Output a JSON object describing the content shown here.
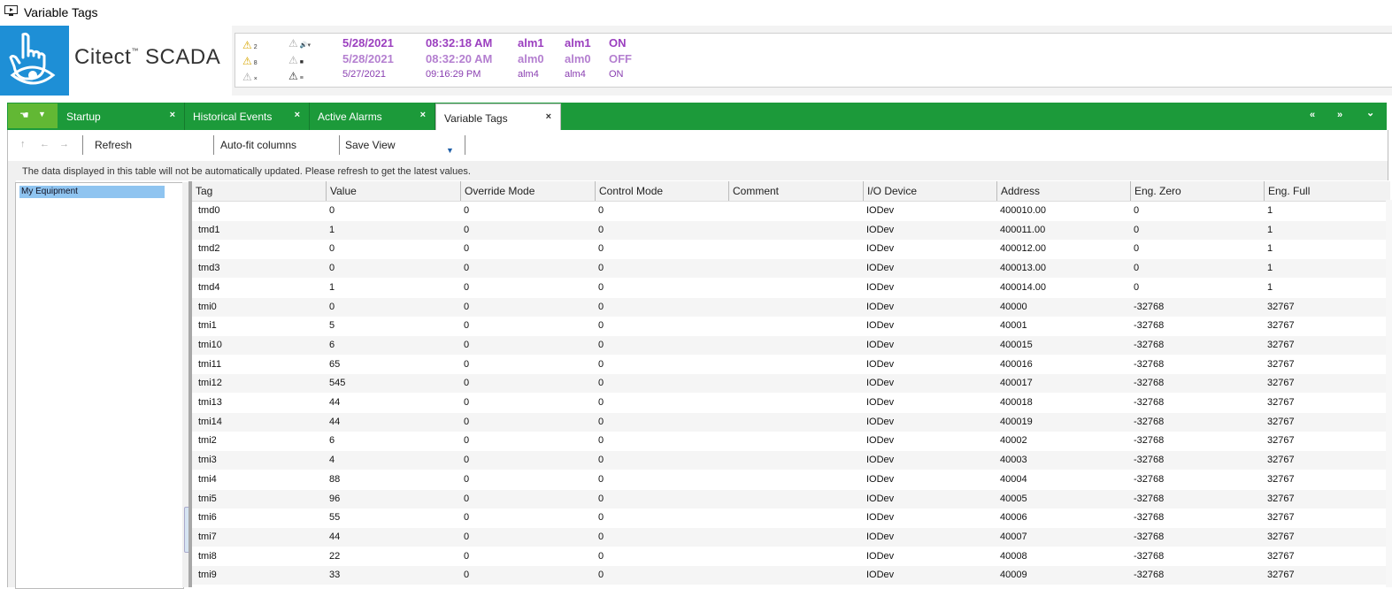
{
  "window": {
    "title": "Variable Tags"
  },
  "brand": {
    "name": "Citect",
    "tm": "™",
    "product": "SCADA",
    "accent": "#1e8fd6"
  },
  "alarm_icons": {
    "count_top": "2",
    "count_mid": "8"
  },
  "alarms": [
    {
      "date": "5/28/2021",
      "time": "08:32:18 AM",
      "tag": "alm1",
      "name": "alm1",
      "state": "ON"
    },
    {
      "date": "5/28/2021",
      "time": "08:32:20 AM",
      "tag": "alm0",
      "name": "alm0",
      "state": "OFF"
    },
    {
      "date": "5/27/2021",
      "time": "09:16:29 PM",
      "tag": "alm4",
      "name": "alm4",
      "state": "ON"
    }
  ],
  "tabs": [
    {
      "label": "Startup",
      "close": "×"
    },
    {
      "label": "Historical Events",
      "close": "×"
    },
    {
      "label": "Active Alarms",
      "close": "×"
    },
    {
      "label": "Variable Tags",
      "close": "×"
    }
  ],
  "tabbar": {
    "color": "#1c9a3a",
    "nav_prev": "«",
    "nav_next": "»",
    "nav_menu": "⌄"
  },
  "toolbar": {
    "back": "↑",
    "prev": "←",
    "next": "→",
    "refresh": "Refresh",
    "autofit": "Auto-fit columns",
    "saveview": "Save View",
    "dropdown": "▼"
  },
  "notice": "The data displayed in this table will not be automatically updated. Please refresh to get the latest values.",
  "tree": {
    "root": "My Equipment"
  },
  "grid": {
    "columns": [
      "Tag",
      "Value",
      "Override Mode",
      "Control Mode",
      "Comment",
      "I/O Device",
      "Address",
      "Eng. Zero",
      "Eng. Full"
    ],
    "rows": [
      [
        "tmd0",
        "0",
        "0",
        "0",
        "",
        "IODev",
        "400010.00",
        "0",
        "1"
      ],
      [
        "tmd1",
        "1",
        "0",
        "0",
        "",
        "IODev",
        "400011.00",
        "0",
        "1"
      ],
      [
        "tmd2",
        "0",
        "0",
        "0",
        "",
        "IODev",
        "400012.00",
        "0",
        "1"
      ],
      [
        "tmd3",
        "0",
        "0",
        "0",
        "",
        "IODev",
        "400013.00",
        "0",
        "1"
      ],
      [
        "tmd4",
        "1",
        "0",
        "0",
        "",
        "IODev",
        "400014.00",
        "0",
        "1"
      ],
      [
        "tmi0",
        "0",
        "0",
        "0",
        "",
        "IODev",
        "40000",
        "-32768",
        "32767"
      ],
      [
        "tmi1",
        "5",
        "0",
        "0",
        "",
        "IODev",
        "40001",
        "-32768",
        "32767"
      ],
      [
        "tmi10",
        "6",
        "0",
        "0",
        "",
        "IODev",
        "400015",
        "-32768",
        "32767"
      ],
      [
        "tmi11",
        "65",
        "0",
        "0",
        "",
        "IODev",
        "400016",
        "-32768",
        "32767"
      ],
      [
        "tmi12",
        "545",
        "0",
        "0",
        "",
        "IODev",
        "400017",
        "-32768",
        "32767"
      ],
      [
        "tmi13",
        "44",
        "0",
        "0",
        "",
        "IODev",
        "400018",
        "-32768",
        "32767"
      ],
      [
        "tmi14",
        "44",
        "0",
        "0",
        "",
        "IODev",
        "400019",
        "-32768",
        "32767"
      ],
      [
        "tmi2",
        "6",
        "0",
        "0",
        "",
        "IODev",
        "40002",
        "-32768",
        "32767"
      ],
      [
        "tmi3",
        "4",
        "0",
        "0",
        "",
        "IODev",
        "40003",
        "-32768",
        "32767"
      ],
      [
        "tmi4",
        "88",
        "0",
        "0",
        "",
        "IODev",
        "40004",
        "-32768",
        "32767"
      ],
      [
        "tmi5",
        "96",
        "0",
        "0",
        "",
        "IODev",
        "40005",
        "-32768",
        "32767"
      ],
      [
        "tmi6",
        "55",
        "0",
        "0",
        "",
        "IODev",
        "40006",
        "-32768",
        "32767"
      ],
      [
        "tmi7",
        "44",
        "0",
        "0",
        "",
        "IODev",
        "40007",
        "-32768",
        "32767"
      ],
      [
        "tmi8",
        "22",
        "0",
        "0",
        "",
        "IODev",
        "40008",
        "-32768",
        "32767"
      ],
      [
        "tmi9",
        "33",
        "0",
        "0",
        "",
        "IODev",
        "40009",
        "-32768",
        "32767"
      ]
    ]
  }
}
